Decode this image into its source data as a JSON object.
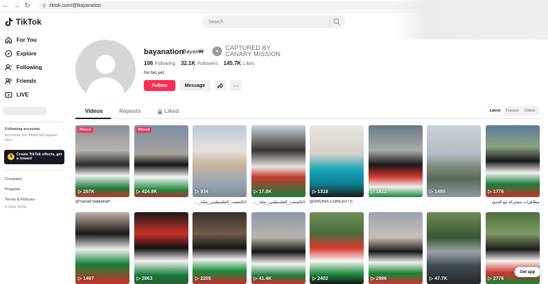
{
  "browser": {
    "url": "tiktok.com/@Bayanation",
    "back": "←",
    "forward": "→",
    "reload": "↻"
  },
  "header": {
    "logo_text": "TikTok",
    "search_placeholder": "Search"
  },
  "sidebar": {
    "items": [
      {
        "label": "For You",
        "icon": "home-icon"
      },
      {
        "label": "Explore",
        "icon": "compass-icon"
      },
      {
        "label": "Following",
        "icon": "following-icon"
      },
      {
        "label": "Friends",
        "icon": "friends-icon"
      },
      {
        "label": "LIVE",
        "icon": "live-icon"
      }
    ],
    "following_title": "Following accounts",
    "following_text": "Accounts you follow will appear here",
    "effects_button": "Create TikTok effects, get a reward",
    "links": [
      "Company",
      "Program",
      "Terms & Policies"
    ],
    "copyright": "© 2024 TikTok"
  },
  "profile": {
    "username": "bayanation",
    "nickname": "Bayan₩",
    "badge_line1": "CAPTURED BY",
    "badge_line2": "CANARY MISSION",
    "following_count": "106",
    "following_label": "Following",
    "followers_count": "32.1K",
    "followers_label": "Followers",
    "likes_count": "145.7K",
    "likes_label": "Likes",
    "bio": "No bio yet.",
    "follow_label": "Follow",
    "message_label": "Message",
    "share_icon": "share-icon",
    "more_icon": "more-icon"
  },
  "tabs": {
    "videos": "Videos",
    "reposts": "Reposts",
    "liked": "Liked"
  },
  "sort": {
    "latest": "Latest",
    "popular": "Popular",
    "oldest": "Oldest"
  },
  "videos": [
    {
      "views": "287K",
      "pinned": "Pinned",
      "caption": "@Sanad balawnah"
    },
    {
      "views": "424.9K",
      "pinned": "Pinned",
      "caption": ""
    },
    {
      "views": "934",
      "pinned": "",
      "caption": "#بالشعب_الفلسطيني_مثله_مثل"
    },
    {
      "views": "17.8K",
      "pinned": "",
      "caption": "#بالشعب_الفلسطيني_مثله_مثل#"
    },
    {
      "views": "1318",
      "pinned": "",
      "caption": "@AROMA CONCEPTS"
    },
    {
      "views": "1822",
      "pinned": "",
      "caption": ""
    },
    {
      "views": "1480",
      "pinned": "",
      "caption": ""
    },
    {
      "views": "1776",
      "pinned": "",
      "caption": "مظاهرات مشتركة مع الجنود"
    },
    {
      "views": "1497",
      "pinned": "",
      "caption": ""
    },
    {
      "views": "2863",
      "pinned": "",
      "caption": ""
    },
    {
      "views": "2205",
      "pinned": "",
      "caption": ""
    },
    {
      "views": "41.4K",
      "pinned": "",
      "caption": ""
    },
    {
      "views": "2402",
      "pinned": "",
      "caption": ""
    },
    {
      "views": "2996",
      "pinned": "",
      "caption": ""
    },
    {
      "views": "47.7K",
      "pinned": "",
      "caption": ""
    },
    {
      "views": "2776",
      "pinned": "",
      "caption": ""
    }
  ],
  "get_app": "Get app",
  "colors": {
    "accent": "#fe2c55",
    "text": "#161823",
    "muted": "#8a8b91"
  }
}
